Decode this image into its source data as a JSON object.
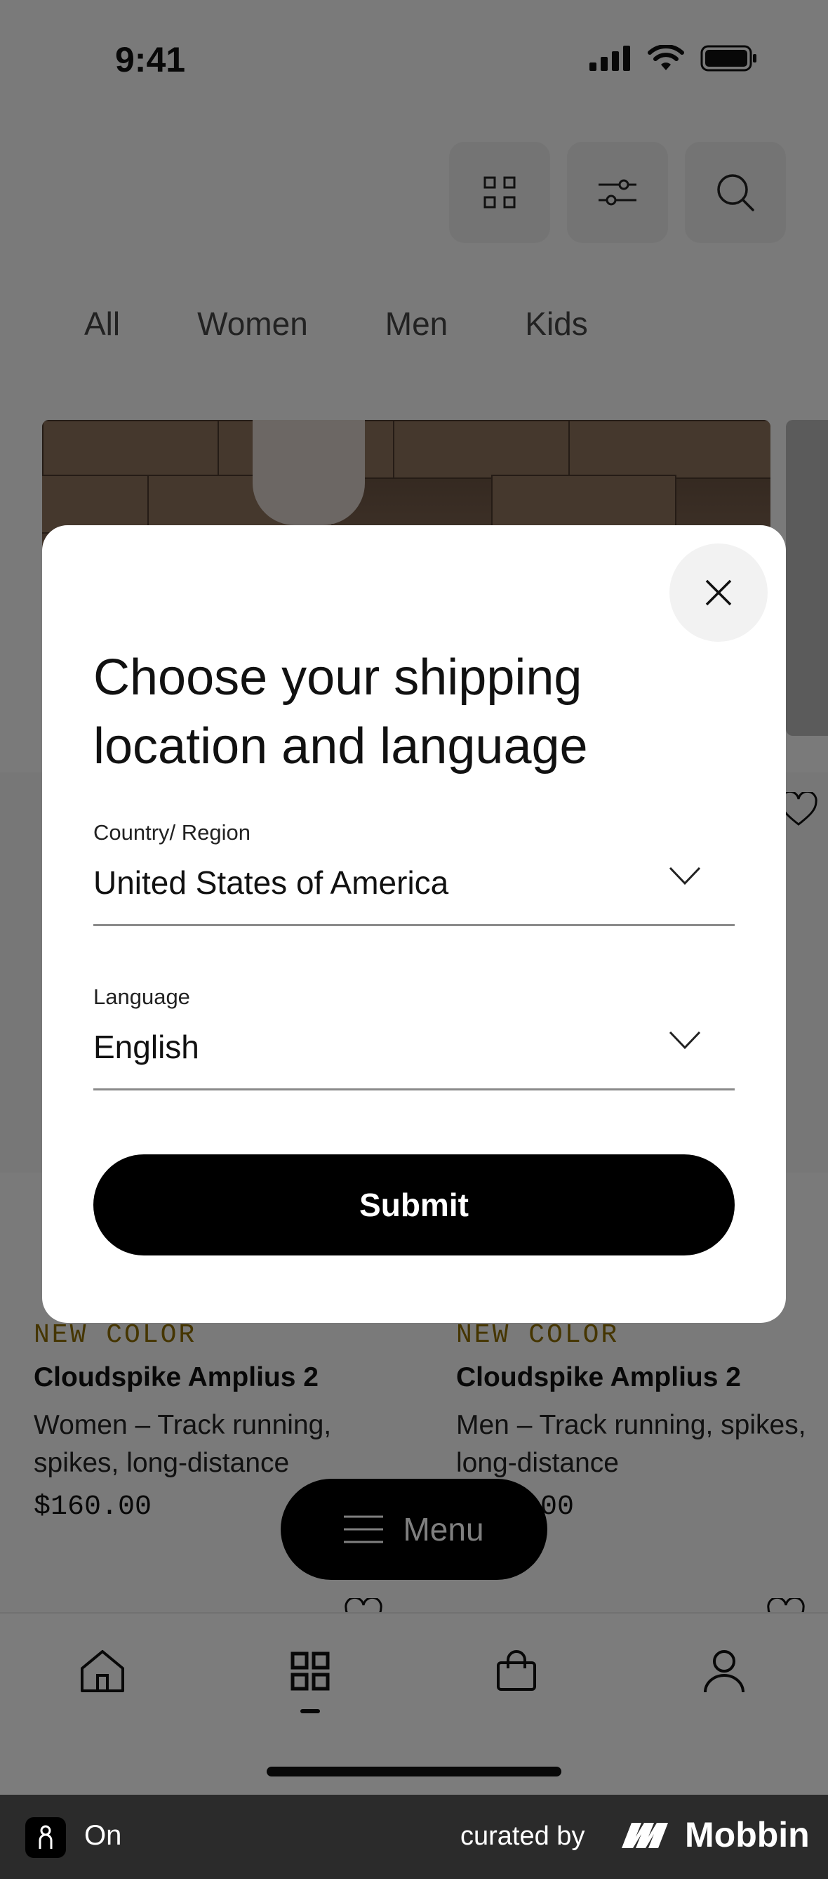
{
  "status_bar": {
    "time": "9:41",
    "icons": [
      "signal-icon",
      "wifi-icon",
      "battery-icon"
    ]
  },
  "toolbar": {
    "icons": [
      "grid-view-icon",
      "filter-sliders-icon",
      "search-icon"
    ]
  },
  "categories": [
    "All",
    "Women",
    "Men",
    "Kids"
  ],
  "products": [
    {
      "badge": "NEW COLOR",
      "name": "Cloudspike Amplius 2",
      "desc": "Women – Track running, spikes, long-distance",
      "price": "$160.00"
    },
    {
      "badge": "NEW COLOR",
      "name": "Cloudspike Amplius 2",
      "desc": "Men – Track running, spikes, long-distance",
      "price": "$160.00"
    }
  ],
  "menu_button": {
    "label": "Menu",
    "icon": "hamburger-icon"
  },
  "tabbar": {
    "items": [
      "home-icon",
      "shop-grid-icon",
      "bag-icon",
      "account-icon"
    ],
    "active": "shop-grid-icon"
  },
  "modal": {
    "title": "Choose your shipping location and language",
    "country": {
      "label": "Country/ Region",
      "value": "United States of America"
    },
    "language": {
      "label": "Language",
      "value": "English"
    },
    "submit_label": "Submit",
    "close_icon": "close-icon"
  },
  "attribution": {
    "app_name": "On",
    "curated_by": "curated by",
    "brand": "Mobbin"
  },
  "colors": {
    "overlay": "rgba(0,0,0,0.5)",
    "primary_button": "#000000",
    "badge": "#8a6a00"
  }
}
